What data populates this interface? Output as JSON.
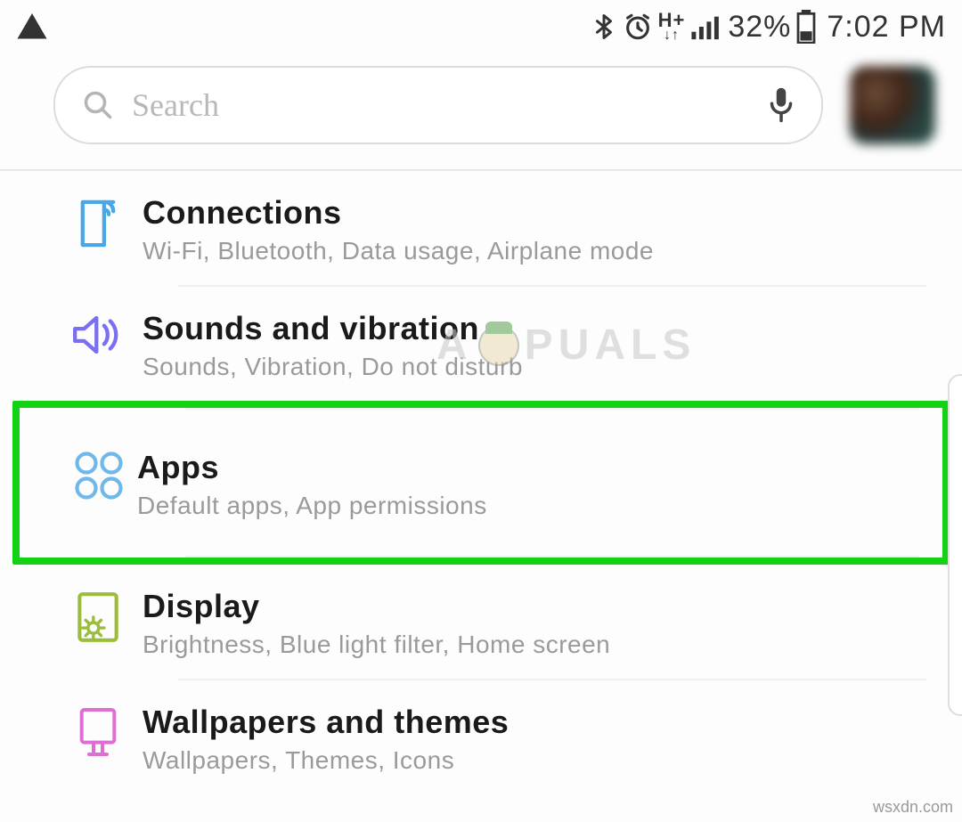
{
  "status": {
    "battery_pct": "32%",
    "clock": "7:02 PM",
    "net_label_top": "H+",
    "net_label_bottom": "↓↑"
  },
  "search": {
    "placeholder": "Search"
  },
  "items": [
    {
      "title": "Connections",
      "subtitle": "Wi-Fi, Bluetooth, Data usage, Airplane mode"
    },
    {
      "title": "Sounds and vibration",
      "subtitle": "Sounds, Vibration, Do not disturb"
    },
    {
      "title": "Apps",
      "subtitle": "Default apps, App permissions"
    },
    {
      "title": "Display",
      "subtitle": "Brightness, Blue light filter, Home screen"
    },
    {
      "title": "Wallpapers and themes",
      "subtitle": "Wallpapers, Themes, Icons"
    }
  ],
  "watermark": "PUALS",
  "credit": "wsxdn.com"
}
